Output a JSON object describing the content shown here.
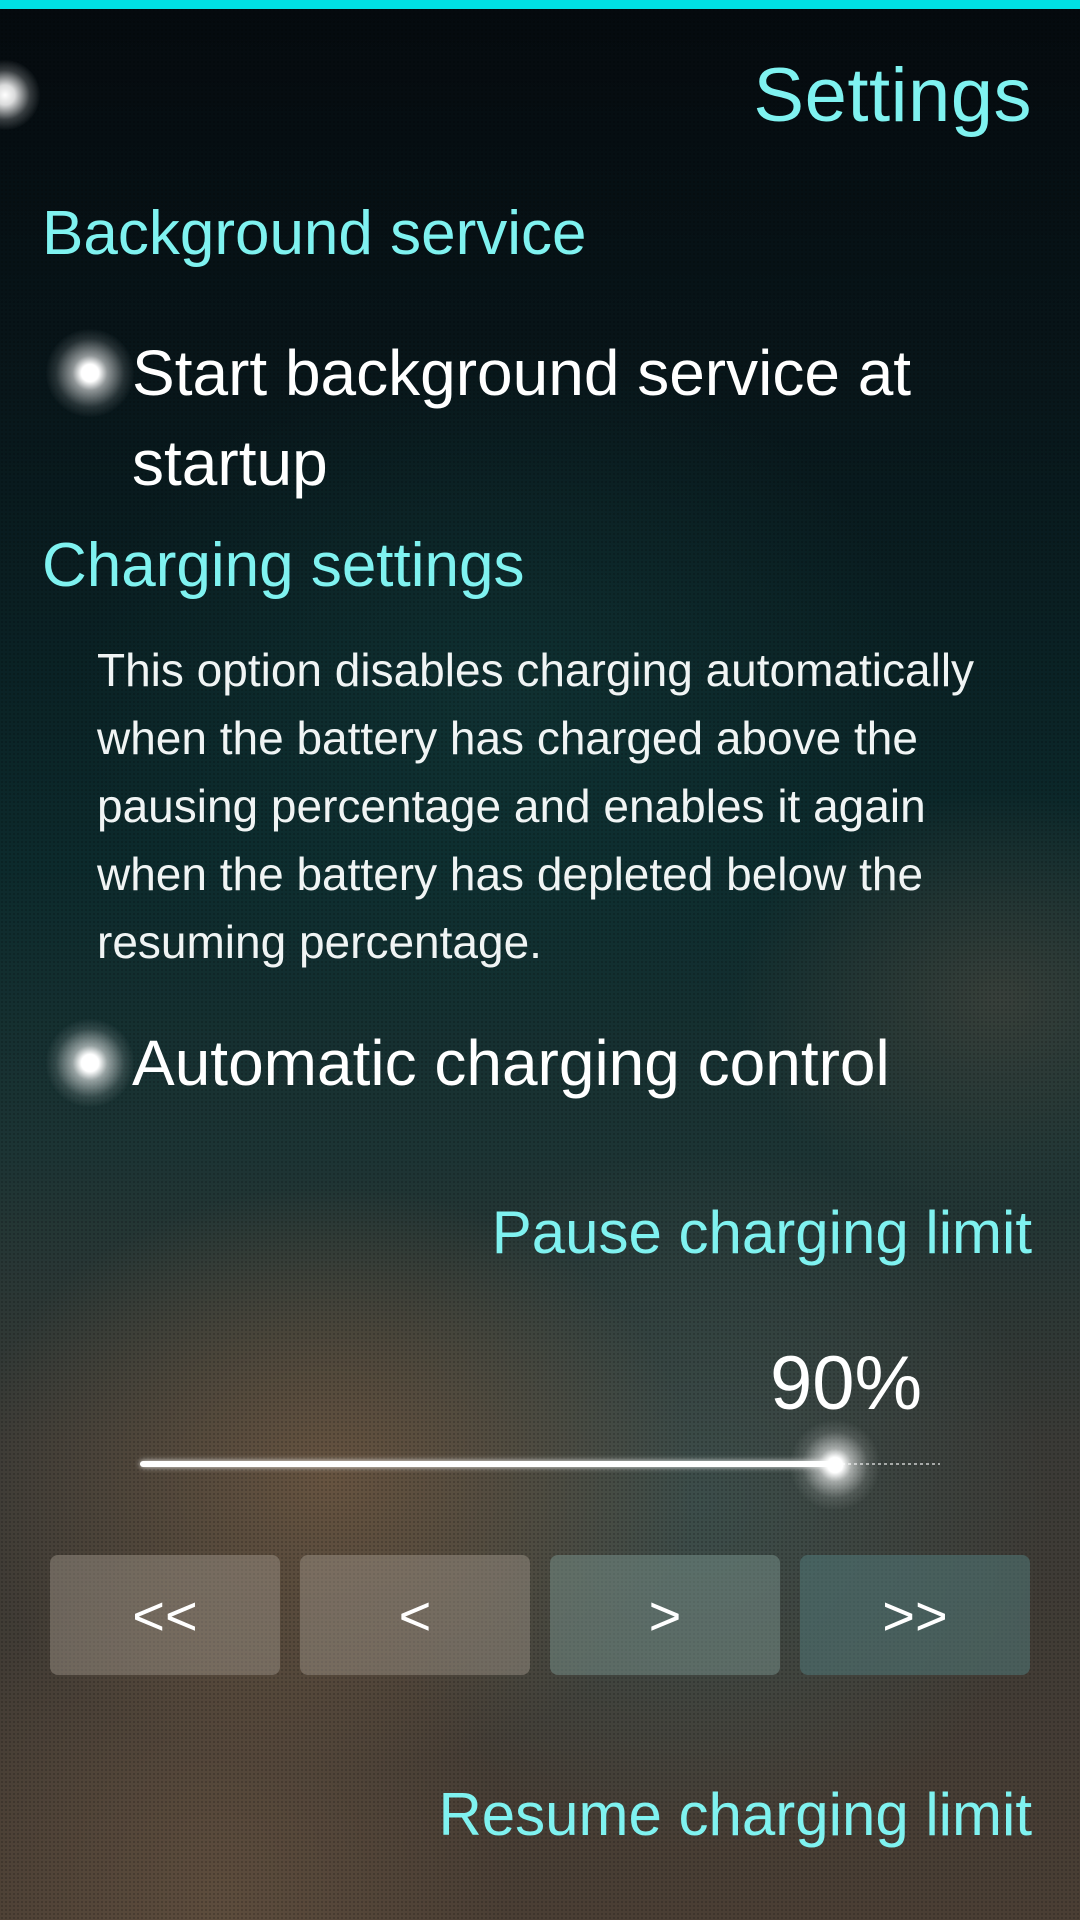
{
  "page": {
    "title": "Settings",
    "accent_color": "#00e0e4",
    "highlight_color": "#7ff2f0"
  },
  "background_service": {
    "header": "Background service",
    "start_at_startup": {
      "label": "Start background service at startup",
      "checked": true
    }
  },
  "charging_settings": {
    "header": "Charging settings",
    "description": "This option disables charging automatically when the battery has charged above the pausing percentage and enables it again when the battery has depleted below the resuming percentage.",
    "automatic_control": {
      "label": "Automatic charging control",
      "checked": true
    },
    "pause_limit": {
      "label": "Pause charging limit",
      "value_text": "90%",
      "value": 90
    },
    "buttons": {
      "decrease_large": "<<",
      "decrease": "<",
      "increase": ">",
      "increase_large": ">>"
    },
    "resume_limit": {
      "label": "Resume charging limit"
    }
  }
}
